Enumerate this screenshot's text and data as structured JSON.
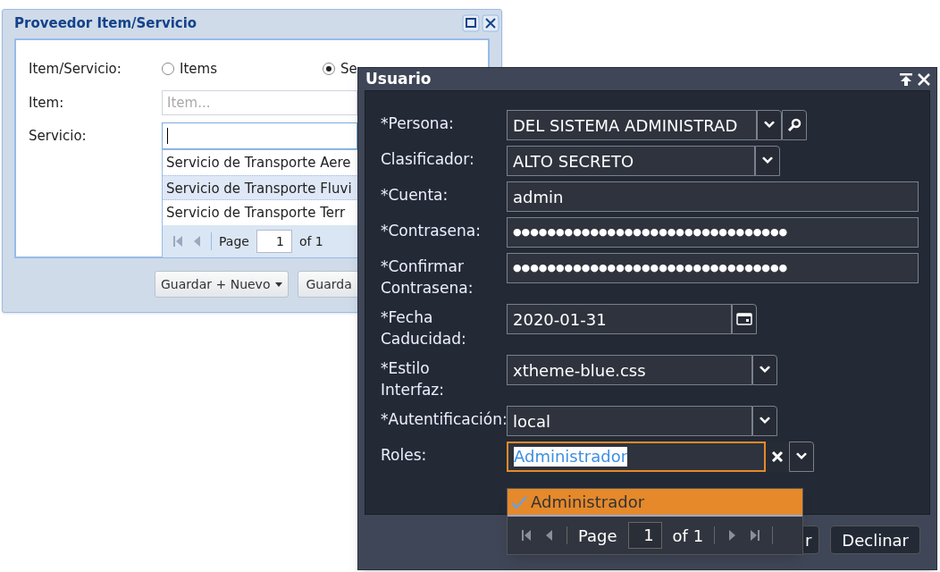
{
  "back_window": {
    "title": "Proveedor Item/Servicio",
    "type_label": "Item/Servicio:",
    "radios": [
      {
        "label": "Items",
        "selected": false
      },
      {
        "label": "Se",
        "selected": true
      }
    ],
    "item_label": "Item:",
    "item_placeholder": "Item...",
    "servicio_label": "Servicio:",
    "servicio_options": [
      {
        "label": "Servicio de Transporte Aere",
        "selected": false
      },
      {
        "label": "Servicio de Transporte Fluvi",
        "selected": true
      },
      {
        "label": "Servicio de Transporte Terr",
        "selected": false
      }
    ],
    "pager": {
      "page_label": "Page",
      "page": "1",
      "of": "of 1"
    },
    "buttons": [
      {
        "label": "Guardar + Nuevo",
        "split": true
      },
      {
        "label": "Guarda",
        "split": false
      }
    ]
  },
  "front_window": {
    "title": "Usuario",
    "fields": [
      {
        "kind": "combo_search",
        "label": "*Persona:",
        "value": "DEL SISTEMA  ADMINISTRAD"
      },
      {
        "kind": "combo",
        "label": "Clasificador:",
        "value": "ALTO SECRETO"
      },
      {
        "kind": "text",
        "label": "*Cuenta:",
        "value": "admin"
      },
      {
        "kind": "text",
        "label": "*Contrasena:",
        "value": "●●●●●●●●●●●●●●●●●●●●●●●●●●●●●●●●"
      },
      {
        "kind": "text",
        "label": "*Confirmar\nContrasena:",
        "value": "●●●●●●●●●●●●●●●●●●●●●●●●●●●●●●●●"
      },
      {
        "kind": "date",
        "label": "*Fecha\nCaducidad:",
        "value": "2020-01-31"
      },
      {
        "kind": "combo",
        "label": "*Estilo\nInterfaz:",
        "value": "xtheme-blue.css"
      },
      {
        "kind": "combo",
        "label": "*Autentificación:",
        "value": "local"
      },
      {
        "kind": "tags",
        "label": "Roles:",
        "value": "Administrador",
        "focused": true
      }
    ],
    "roles_options": [
      {
        "label": "Administrador",
        "checked": true,
        "selected": true
      }
    ],
    "pager": {
      "page_label": "Page",
      "page": "1",
      "of": "of 1"
    },
    "buttons": [
      "r",
      "Declinar"
    ]
  }
}
